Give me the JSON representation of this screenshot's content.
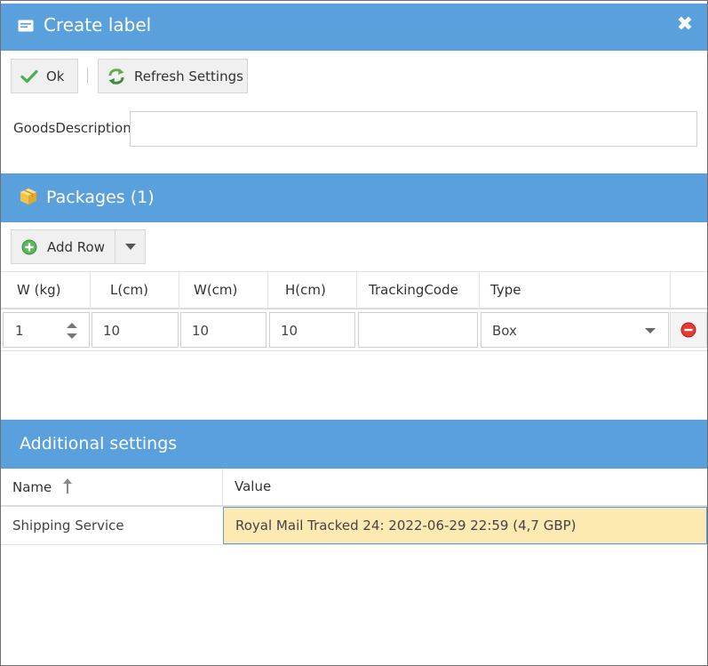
{
  "dialog": {
    "title": "Create label",
    "close_symbol": "✖"
  },
  "toolbar": {
    "ok_label": "Ok",
    "refresh_label": "Refresh Settings"
  },
  "form": {
    "goods_description_label": "GoodsDescription",
    "goods_description_value": ""
  },
  "packages": {
    "header": "Packages (1)",
    "add_row_label": "Add Row",
    "columns": [
      "W (kg)",
      "L(cm)",
      "W(cm)",
      "H(cm)",
      "TrackingCode",
      "Type"
    ],
    "rows": [
      {
        "weight": "1",
        "length": "10",
        "width": "10",
        "height": "10",
        "tracking_code": "",
        "type": "Box"
      }
    ]
  },
  "additional": {
    "header": "Additional settings",
    "columns": {
      "name": "Name",
      "value": "Value"
    },
    "rows": [
      {
        "name": "Shipping Service",
        "value": "Royal Mail Tracked 24: 2022-06-29 22:59 (4,7 GBP)"
      }
    ]
  },
  "colors": {
    "header_blue": "#5aa0dc",
    "selected_cell": "#fde9b2",
    "ok_check_green": "#4caf50",
    "delete_red": "#e53935"
  },
  "icons": {
    "title": "label-icon",
    "close": "close-icon",
    "ok": "checkmark-icon",
    "refresh": "refresh-icon",
    "packages": "package-box-icon",
    "add_row": "add-circle-icon",
    "dropdown": "caret-down-icon",
    "sort": "sort-ascending-icon",
    "delete": "delete-row-icon"
  }
}
